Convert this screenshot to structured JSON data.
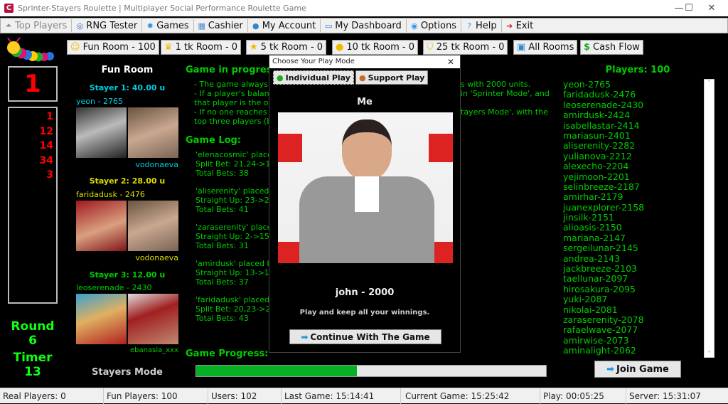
{
  "window": {
    "title": "Sprinter-Stayers Roulette | Multiplayer Social Performance Roulette Game",
    "app_icon": "C",
    "minimize": "—",
    "maximize": "☐",
    "close": "✕"
  },
  "menu": [
    {
      "label": "Top Players",
      "icon": "top-players-icon",
      "disabled": true
    },
    {
      "label": "RNG Tester",
      "icon": "compass-icon"
    },
    {
      "label": "Games",
      "icon": "gear-icon"
    },
    {
      "label": "Cashier",
      "icon": "calculator-icon"
    },
    {
      "label": "My Account",
      "icon": "user-icon"
    },
    {
      "label": "My Dashboard",
      "icon": "monitor-icon"
    },
    {
      "label": "Options",
      "icon": "options-icon"
    },
    {
      "label": "Help",
      "icon": "help-icon"
    },
    {
      "label": "Exit",
      "icon": "exit-icon"
    }
  ],
  "rooms": [
    {
      "label": "Fun Room - 100",
      "icon": "smiley-icon"
    },
    {
      "label": "1 tk Room - 0",
      "icon": "crown-icon"
    },
    {
      "label": "5 tk Room - 0",
      "icon": "star-icon"
    },
    {
      "label": "10 tk Room - 0",
      "icon": "sun-icon"
    },
    {
      "label": "25 tk Room - 0",
      "icon": "shield-icon"
    },
    {
      "label": "All Rooms",
      "icon": "tv-icon"
    },
    {
      "label": "Cash Flow",
      "icon": "dollar-icon"
    }
  ],
  "left": {
    "current_number": "1",
    "history": [
      "1",
      "12",
      "14",
      "34",
      "3"
    ],
    "round_label": "Round",
    "round": "6",
    "timer_label": "Timer",
    "timer": "13"
  },
  "room": {
    "title": "Fun Room",
    "mode": "Stayers Mode",
    "stayers": [
      {
        "title": "Stayer 1: 40.00 u",
        "player": "yeon - 2765",
        "supporter": "vodonaeva",
        "color": "#00ccdd"
      },
      {
        "title": "Stayer 2: 28.00 u",
        "player": "faridadusk - 2476",
        "supporter": "vodonaeva",
        "color": "#dddd00"
      },
      {
        "title": "Stayer 3: 12.00 u",
        "player": "leoserenade - 2430",
        "supporter": "ebanasia_xxx",
        "color": "#00cc00"
      }
    ]
  },
  "game": {
    "progress_title": "Game in progress",
    "rules": [
      "- The game always s",
      "s with 2000 units.",
      "- If a player's balanc",
      " in 'Sprinter Mode', and",
      "that player is the on",
      "- If no one reaches ",
      "tayers Mode', with the",
      "top three players (b"
    ],
    "log_title": "Game Log:",
    "log": [
      [
        "'elenacosmic' placed",
        "Split Bet: 21,24->1",
        "Total Bets: 38"
      ],
      [
        "'aliserenity' placed b",
        "Straight Up: 23->2",
        "Total Bets: 41"
      ],
      [
        "'zaraserenity' placed",
        "Straight Up: 2->15;",
        "Total Bets: 31"
      ],
      [
        "'amirdusk' placed be",
        "Straight Up: 13->1",
        "Total Bets: 37"
      ],
      [
        "'faridadusk' placed b",
        "Split Bet: 20,23->2",
        "Total Bets: 43"
      ]
    ],
    "game_progress_label": "Game Progress:",
    "progress": 0.46
  },
  "dialog": {
    "title": "Choose Your Play Mode",
    "tab_individual": "Individual Play",
    "tab_support": "Support Play",
    "me": "Me",
    "player": "john - 2000",
    "description": "Play and keep all your winnings.",
    "continue": "Continue With The Game"
  },
  "players": {
    "title": "Players: 100",
    "list": [
      "yeon-2765",
      "faridadusk-2476",
      "leoserenade-2430",
      "amirdusk-2424",
      "isabellastar-2414",
      "mariasun-2401",
      "aliserenity-2282",
      "yulianova-2212",
      "alexecho-2204",
      "yejimoon-2201",
      "selinbreeze-2187",
      "amirhar-2179",
      "juanexplorer-2158",
      "jinsilk-2151",
      "alioasis-2150",
      "mariana-2147",
      "sergeilunar-2145",
      "andrea-2143",
      "jackbreeze-2103",
      "taellunar-2097",
      "hirosakura-2095",
      "yuki-2087",
      "nikolai-2081",
      "zaraserenity-2078",
      "rafaelwave-2077",
      "amirwise-2073",
      "aminalight-2062"
    ],
    "join": "Join Game"
  },
  "status": [
    "Real Players: 0",
    "Fun Players: 100",
    "Users: 102",
    "Last Game: 15:14:41",
    "Current Game: 15:25:42",
    "Play: 00:05:25",
    "Server: 15:31:07"
  ]
}
